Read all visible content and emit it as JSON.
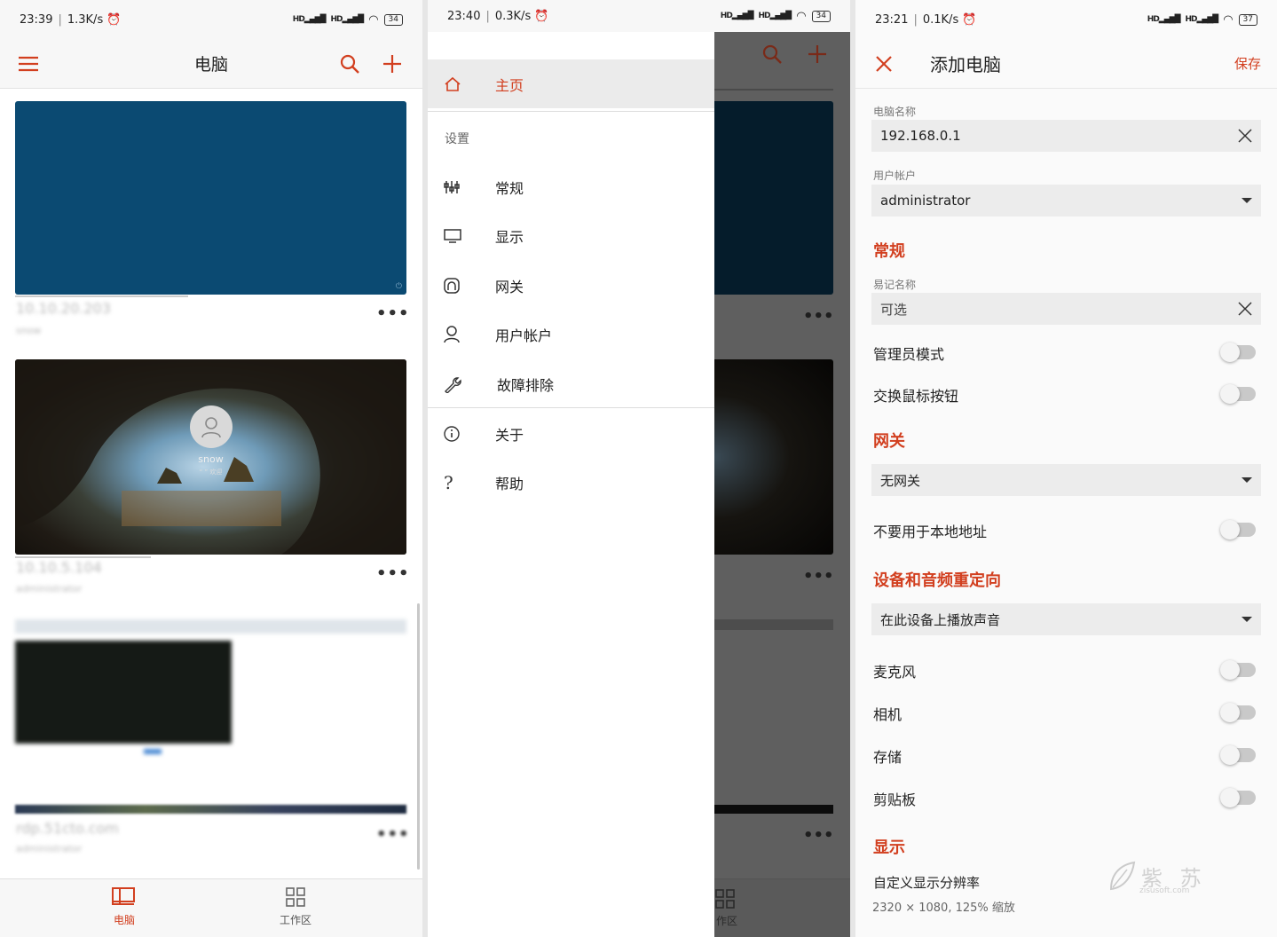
{
  "panel1": {
    "status": {
      "time": "23:39",
      "speed": "1.3K/s",
      "battery": "34"
    },
    "title": "电脑",
    "cards": [
      {
        "name": "10.10.20.203",
        "user": "snow"
      },
      {
        "name": "10.10.5.104",
        "user": "administrator",
        "lock_user": "snow",
        "lock_sub": "“ ” 欢迎"
      },
      {
        "name": "rdp.51cto.com",
        "user": "administrator"
      }
    ],
    "nav": {
      "computers": "电脑",
      "workspaces": "工作区"
    }
  },
  "panel2": {
    "status": {
      "time": "23:40",
      "speed": "0.3K/s",
      "battery": "34"
    },
    "menu": {
      "home": "主页",
      "settings_header": "设置",
      "general": "常规",
      "display": "显示",
      "gateway": "网关",
      "user_accounts": "用户帐户",
      "troubleshoot": "故障排除",
      "about": "关于",
      "help": "帮助"
    },
    "nav": {
      "workspaces_partial": "作区"
    }
  },
  "panel3": {
    "status": {
      "time": "23:21",
      "speed": "0.1K/s",
      "battery": "37"
    },
    "title": "添加电脑",
    "save": "保存",
    "pc_name_label": "电脑名称",
    "pc_name_value": "192.168.0.1",
    "user_account_label": "用户帐户",
    "user_account_value": "administrator",
    "section_general": "常规",
    "friendly_name_label": "易记名称",
    "friendly_name_placeholder": "可选",
    "admin_mode": "管理员模式",
    "swap_mouse": "交换鼠标按钮",
    "section_gateway": "网关",
    "gateway_value": "无网关",
    "bypass_local": "不要用于本地地址",
    "section_redirect": "设备和音频重定向",
    "sound_value": "在此设备上播放声音",
    "microphone": "麦克风",
    "camera": "相机",
    "storage": "存储",
    "clipboard": "剪贴板",
    "section_display": "显示",
    "custom_resolution": "自定义显示分辨率",
    "resolution_value": "2320 × 1080, 125% 缩放",
    "watermark_cn": "紫 苏",
    "watermark_url": "zisusoft.com"
  },
  "colors": {
    "accent": "#d23f1f",
    "card_blue": "#0b4a72"
  }
}
